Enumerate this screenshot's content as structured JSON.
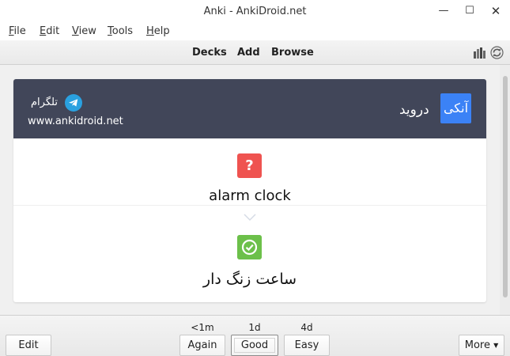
{
  "window": {
    "title": "Anki - AnkiDroid.net",
    "minimize_glyph": "—",
    "maximize_glyph": "☐",
    "close_glyph": "✕"
  },
  "menu": {
    "file": {
      "accel": "F",
      "rest": "ile"
    },
    "edit": {
      "accel": "E",
      "rest": "dit"
    },
    "view": {
      "accel": "V",
      "rest": "iew"
    },
    "tools": {
      "accel": "T",
      "rest": "ools"
    },
    "help": {
      "accel": "H",
      "rest": "elp"
    }
  },
  "toolbar": {
    "decks": "Decks",
    "add": "Add",
    "browse": "Browse",
    "icons": [
      "stats-icon",
      "sync-icon"
    ]
  },
  "card": {
    "header": {
      "telegram_label": "تلگرام",
      "site_url": "www.ankidroid.net",
      "brand_box": "آنکی",
      "brand_name": "درويد",
      "background": "#414659",
      "brand_color": "#3b82f6",
      "telegram_color": "#2aa1e0"
    },
    "question_glyph": "?",
    "question_color": "#ef5350",
    "answer_color": "#6cc04a",
    "front": "alarm clock",
    "back": "ساعت زنگ دار"
  },
  "bottom": {
    "edit": "Edit",
    "again": {
      "label": "Again",
      "interval": "<1m"
    },
    "good": {
      "label": "Good",
      "interval": "1d"
    },
    "easy": {
      "label": "Easy",
      "interval": "4d"
    },
    "more": "More",
    "more_caret": "▼"
  }
}
